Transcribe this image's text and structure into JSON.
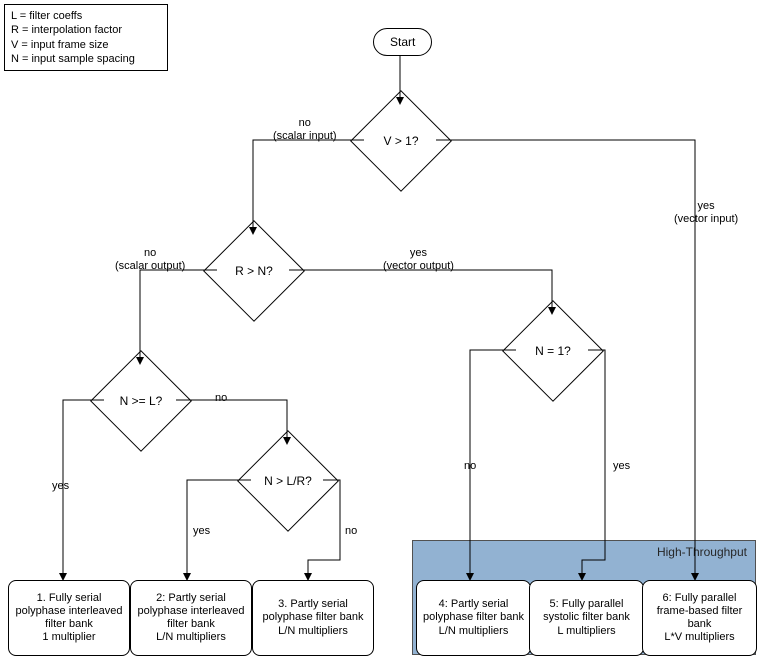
{
  "legend": {
    "line1": "L = filter coeffs",
    "line2": "R = interpolation factor",
    "line3": "V = input frame size",
    "line4": "N = input sample spacing"
  },
  "start": {
    "label": "Start"
  },
  "decisions": {
    "v_gt_1": {
      "text": "V > 1?"
    },
    "r_gt_n": {
      "text": "R > N?"
    },
    "n_ge_l": {
      "text": "N >= L?"
    },
    "n_gt_l_over_r": {
      "text": "N > L/R?"
    },
    "n_eq_1": {
      "text": "N = 1?"
    }
  },
  "edge_labels": {
    "v_no": "no",
    "v_no_sub": "(scalar input)",
    "v_yes": "yes",
    "v_yes_sub": "(vector input)",
    "rn_no": "no",
    "rn_no_sub": "(scalar output)",
    "rn_yes": "yes",
    "rn_yes_sub": "(vector output)",
    "nl_yes": "yes",
    "nl_no": "no",
    "nlr_yes": "yes",
    "nlr_no": "no",
    "n1_no": "no",
    "n1_yes": "yes"
  },
  "region": {
    "title": "High-Throughput"
  },
  "outcomes": {
    "o1": "1. Fully serial polyphase interleaved filter bank\n1 multiplier",
    "o2": "2: Partly serial polyphase interleaved filter bank\nL/N multipliers",
    "o3": "3. Partly serial polyphase filter bank\nL/N multipliers",
    "o4": "4: Partly serial polyphase filter bank\nL/N multipliers",
    "o5": "5: Fully parallel systolic filter bank\nL multipliers",
    "o6": "6: Fully parallel frame-based filter bank\nL*V multipliers"
  }
}
